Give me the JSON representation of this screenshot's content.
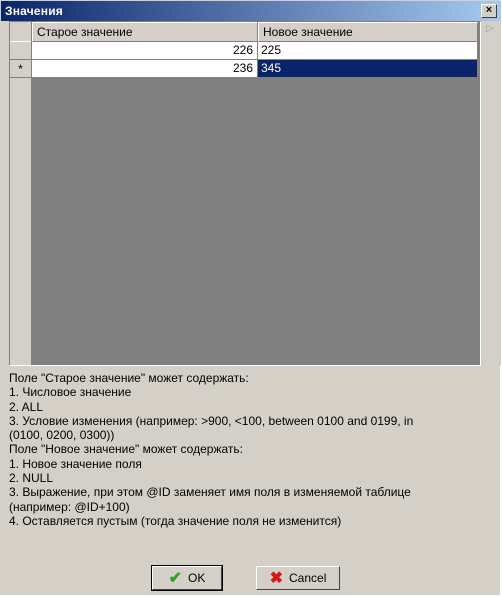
{
  "window": {
    "title": "Значения",
    "close_glyph": "×"
  },
  "grid": {
    "columns": [
      "Старое значение",
      "Новое значение"
    ],
    "rows": [
      {
        "indicator": "",
        "old": "226",
        "new": "225"
      },
      {
        "indicator": "*",
        "old": "236",
        "new": "345"
      }
    ]
  },
  "help": {
    "lines": [
      "Поле \"Старое значение\" может содержать:",
      "1. Числовое значение",
      "2. ALL",
      "3. Условие изменения (например: >900, <100, between 0100 and 0199, in",
      "(0100, 0200, 0300))",
      "Поле \"Новое значение\" может содержать:",
      "1. Новое значение поля",
      "2. NULL",
      "3. Выражение, при этом @ID заменяет имя поля в изменяемой таблице",
      "(например: @ID+100)",
      "4. Оставляется пустым (тогда значение поля не изменится)"
    ]
  },
  "buttons": {
    "ok_label": "OK",
    "cancel_label": "Cancel"
  },
  "icons": {
    "ok": "checkmark-icon",
    "cancel": "x-icon"
  },
  "colors": {
    "titlebar": "#0a246a",
    "selection": "#0a246a",
    "face": "#d4d0c8"
  }
}
